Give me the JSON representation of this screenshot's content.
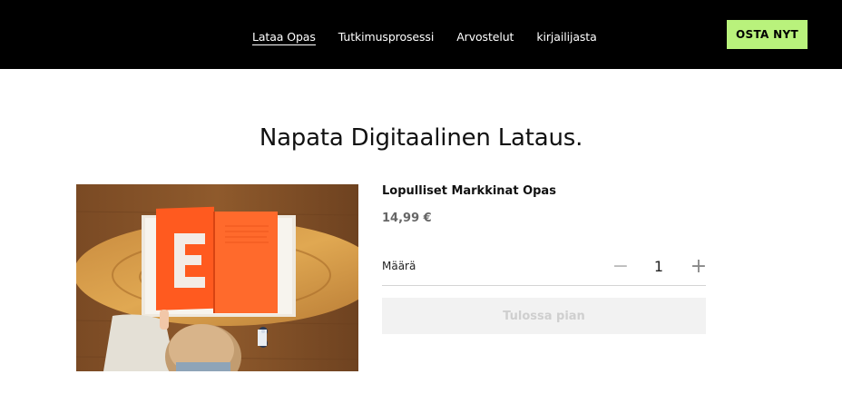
{
  "nav": {
    "items": [
      {
        "label": "Lataa Opas",
        "active": true
      },
      {
        "label": "Tutkimusprosessi",
        "active": false
      },
      {
        "label": "Arvostelut",
        "active": false
      },
      {
        "label": "kirjailijasta",
        "active": false
      }
    ],
    "cta_label": "OSTA NYT"
  },
  "heading": "Napata Digitaalinen Lataus.",
  "product": {
    "name": "Lopulliset Markkinat Opas",
    "price": "14,99 €",
    "quantity_label": "Määrä",
    "quantity_value": "1",
    "minus_symbol": "−",
    "plus_symbol": "+",
    "button_label": "Tulossa pian",
    "image_icon": "book-photo"
  },
  "colors": {
    "header_bg": "#000000",
    "cta_bg": "#b9f27c",
    "price": "#666666",
    "button_bg": "#f2f2f2",
    "button_text": "#cfcfcf"
  }
}
